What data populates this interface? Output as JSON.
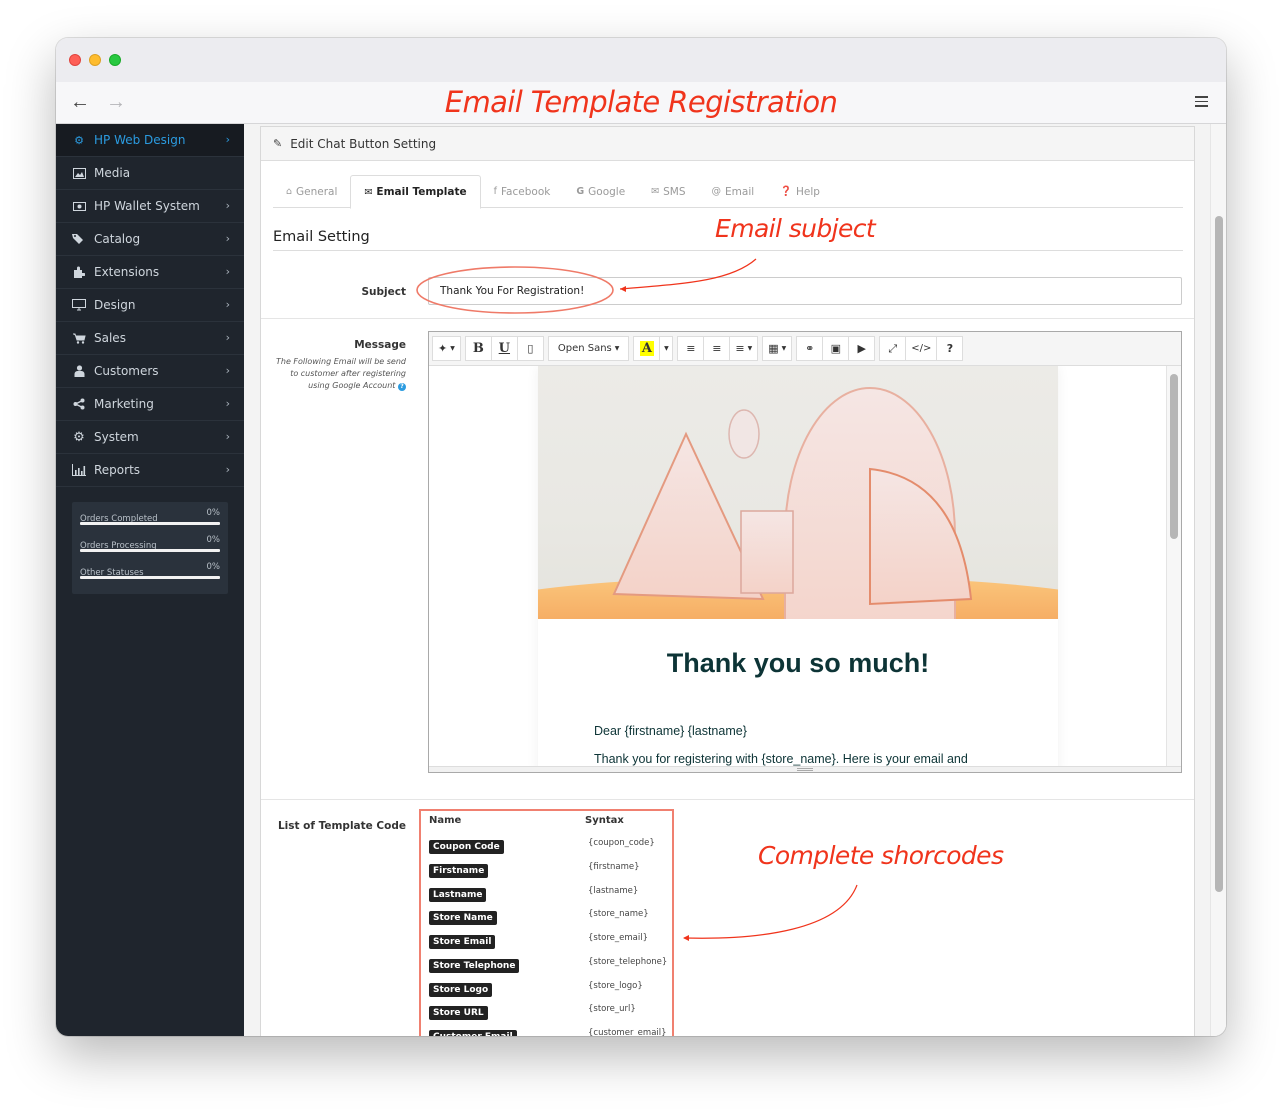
{
  "window": {
    "annotation_title": "Email Template Registration"
  },
  "sidebar": {
    "items": [
      {
        "label": "HP Web Design",
        "icon": "cogs-icon",
        "has_chevron": true,
        "active": true
      },
      {
        "label": "Media",
        "icon": "image-icon",
        "has_chevron": false,
        "active": false
      },
      {
        "label": "HP Wallet System",
        "icon": "money-icon",
        "has_chevron": true,
        "active": false
      },
      {
        "label": "Catalog",
        "icon": "tags-icon",
        "has_chevron": true,
        "active": false
      },
      {
        "label": "Extensions",
        "icon": "puzzle-icon",
        "has_chevron": true,
        "active": false
      },
      {
        "label": "Design",
        "icon": "desktop-icon",
        "has_chevron": true,
        "active": false
      },
      {
        "label": "Sales",
        "icon": "cart-icon",
        "has_chevron": true,
        "active": false
      },
      {
        "label": "Customers",
        "icon": "user-icon",
        "has_chevron": true,
        "active": false
      },
      {
        "label": "Marketing",
        "icon": "share-icon",
        "has_chevron": true,
        "active": false
      },
      {
        "label": "System",
        "icon": "gear-icon",
        "has_chevron": true,
        "active": false
      },
      {
        "label": "Reports",
        "icon": "bar-chart-icon",
        "has_chevron": true,
        "active": false
      }
    ],
    "stats": [
      {
        "label": "Orders Completed",
        "value": "0%",
        "progress": 0
      },
      {
        "label": "Orders Processing",
        "value": "0%",
        "progress": 0
      },
      {
        "label": "Other Statuses",
        "value": "0%",
        "progress": 0
      }
    ]
  },
  "panel": {
    "heading": "Edit Chat Button Setting",
    "tabs": [
      {
        "label": "General",
        "icon": "home-icon",
        "active": false
      },
      {
        "label": "Email Template",
        "icon": "envelope-icon",
        "active": true
      },
      {
        "label": "Facebook",
        "icon": "facebook-icon",
        "active": false
      },
      {
        "label": "Google",
        "icon": "google-icon",
        "active": false
      },
      {
        "label": "SMS",
        "icon": "envelope-icon",
        "active": false
      },
      {
        "label": "Email",
        "icon": "at-icon",
        "active": false
      },
      {
        "label": "Help",
        "icon": "question-circle-icon",
        "active": false
      }
    ],
    "section_title": "Email Setting",
    "subject": {
      "label": "Subject",
      "value": "Thank You For Registration!"
    },
    "message": {
      "label": "Message",
      "help": "The Following Email will be send to customer after registering using Google Account",
      "toolbar": {
        "font": "Open Sans"
      },
      "content": {
        "heading": "Thank you so much!",
        "greeting": "Dear {firstname} {lastname}",
        "body": "Thank you for registering with {store_name}. Here is your email and"
      }
    },
    "template_codes": {
      "label": "List of Template Code",
      "col_name": "Name",
      "col_syntax": "Syntax",
      "rows": [
        {
          "name": "Coupon Code",
          "syntax": "{coupon_code}"
        },
        {
          "name": "Firstname",
          "syntax": "{firstname}"
        },
        {
          "name": "Lastname",
          "syntax": "{lastname}"
        },
        {
          "name": "Store Name",
          "syntax": "{store_name}"
        },
        {
          "name": "Store Email",
          "syntax": "{store_email}"
        },
        {
          "name": "Store Telephone",
          "syntax": "{store_telephone}"
        },
        {
          "name": "Store Logo",
          "syntax": "{store_logo}"
        },
        {
          "name": "Store URL",
          "syntax": "{store_url}"
        },
        {
          "name": "Customer Email",
          "syntax": "{customer_email}"
        }
      ]
    }
  },
  "annotations": {
    "email_subject": "Email subject",
    "shortcodes": "Complete shorcodes",
    "color": "#f0341c"
  }
}
